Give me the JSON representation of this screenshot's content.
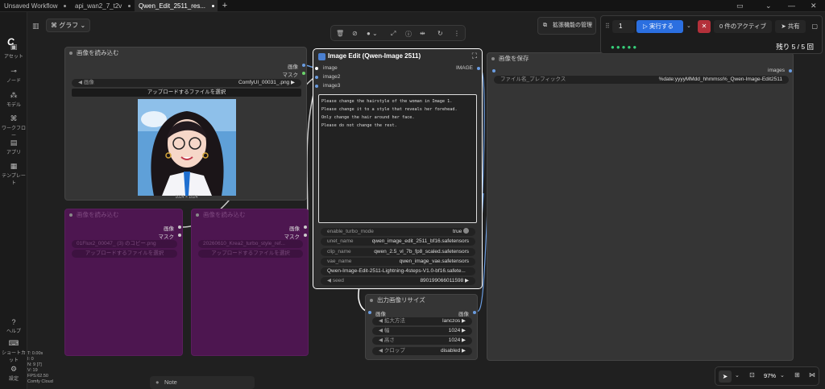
{
  "tabs": [
    {
      "label": "Unsaved Workflow"
    },
    {
      "label": "api_wan2_7_t2v"
    },
    {
      "label": "Qwen_Edit_2511_res..."
    }
  ],
  "sidebar": {
    "items": [
      {
        "label": "アセット",
        "icon": "image-icon"
      },
      {
        "label": "ノード",
        "icon": "node-icon"
      },
      {
        "label": "モデル",
        "icon": "model-icon"
      },
      {
        "label": "ワークフロー",
        "icon": "workflow-icon"
      },
      {
        "label": "アプリ",
        "icon": "app-icon"
      },
      {
        "label": "テンプレート",
        "icon": "template-icon"
      },
      {
        "label": "ヘルプ",
        "icon": "help-icon"
      },
      {
        "label": "ショートカット",
        "icon": "keyboard-icon"
      },
      {
        "label": "設定",
        "icon": "gear-icon"
      }
    ]
  },
  "stats": [
    "T: 0.00s",
    "I: 0",
    "N: 9 [7]",
    "V: 19",
    "FPS:62.50",
    "Comfy Cloud"
  ],
  "graph_button": "グラフ",
  "ext_button": "拡張機能の管理",
  "run": {
    "count": "1",
    "run_label": "実行する",
    "active": "0 件のアクティブ",
    "share": "共有",
    "remaining": "残り 5 / 5 回"
  },
  "load_image": {
    "title": "画像を読み込む",
    "out_image": "画像",
    "out_mask": "マスク",
    "image_label": "画像",
    "image_value": "ComfyUI_00031_.png",
    "upload": "アップロードするファイルを選択",
    "dims": "1024 × 1024"
  },
  "load_image2": {
    "title": "画像を読み込む",
    "out_image": "画像",
    "out_mask": "マスク",
    "file": "01Flux2_00047_ (3) のコピー.png",
    "upload": "アップロードするファイルを選択"
  },
  "load_image3": {
    "title": "画像を読み込む",
    "out_image": "画像",
    "out_mask": "マスク",
    "file": "20260610_Krea2_turbo_style_ref...",
    "upload": "アップロードするファイルを選択"
  },
  "qwen": {
    "title": "Image Edit (Qwen-Image 2511)",
    "inputs": [
      "image",
      "image2",
      "image3"
    ],
    "output": "IMAGE",
    "prompt": [
      "Please change the hairstyle of the woman in Image 1.",
      "Please change it to a style that reveals her forehead.",
      "Only change the hair around her face.",
      "Please do not change the rest."
    ],
    "widgets": [
      {
        "label": "enable_turbo_mode",
        "value": "true"
      },
      {
        "label": "unet_name",
        "value": "qwen_image_edit_2511_bf16.safetensors"
      },
      {
        "label": "clip_name",
        "value": "qwen_2.5_vl_7b_fp8_scaled.safetensors"
      },
      {
        "label": "vae_name",
        "value": "qwen_image_vae.safetensors"
      },
      {
        "label": "",
        "value": "Qwen-Image-Edit-2511-Lightning-4steps-V1.0-bf16.safete..."
      },
      {
        "label": "seed",
        "value": "890199066011598"
      }
    ]
  },
  "save": {
    "title": "画像を保存",
    "in": "images",
    "prefix_label": "ファイル名_プレフィックス",
    "prefix_value": "%date:yyyyMMdd_hhmmss%_Qwen-Image-Edit2511"
  },
  "resize": {
    "title": "出力画像リサイズ",
    "in": "画像",
    "out": "画像",
    "widgets": [
      {
        "label": "拡大方法",
        "value": "lanczos"
      },
      {
        "label": "幅",
        "value": "1024"
      },
      {
        "label": "高さ",
        "value": "1024"
      },
      {
        "label": "クロップ",
        "value": "disabled"
      }
    ]
  },
  "note": "Note",
  "zoom": "97%"
}
